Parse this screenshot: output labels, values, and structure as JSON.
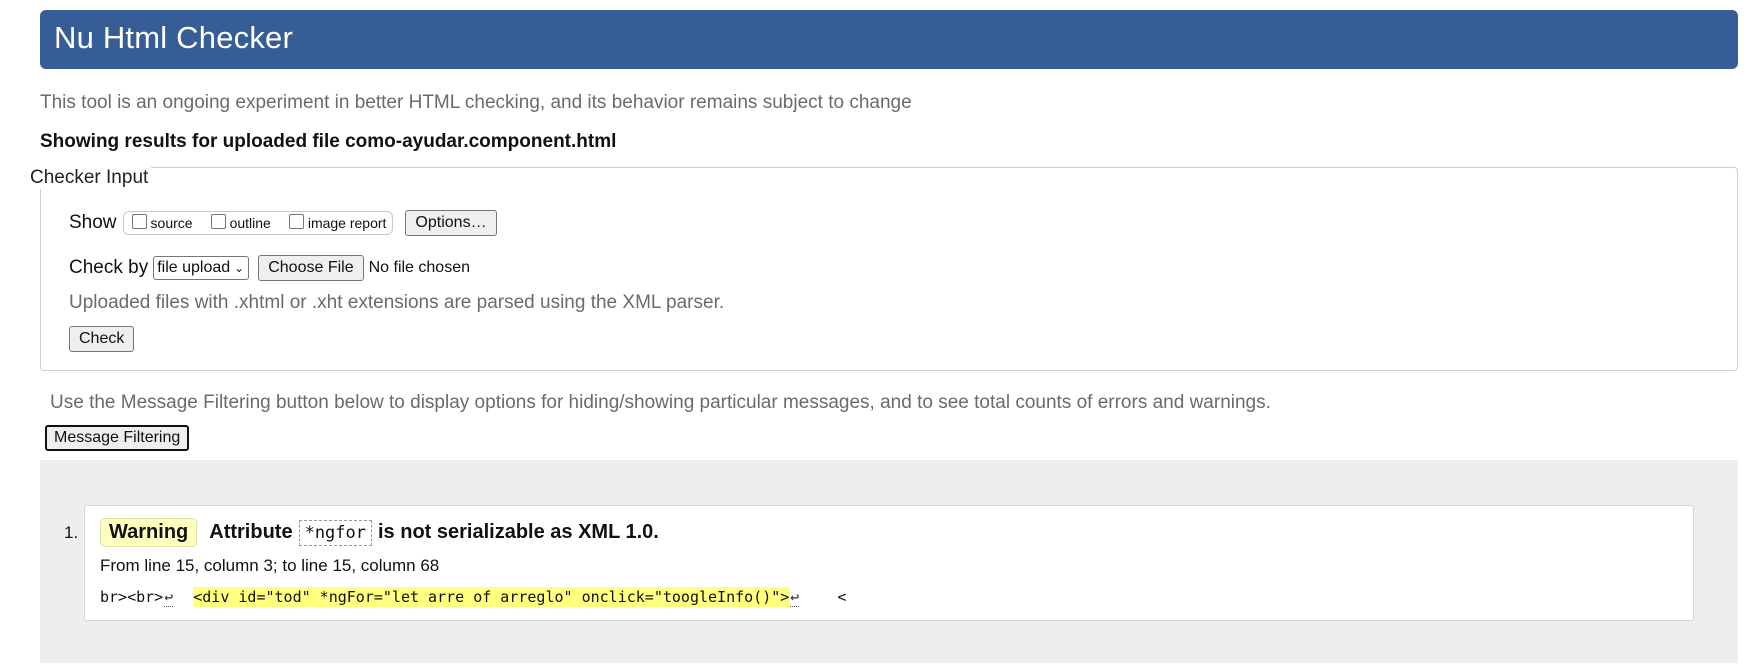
{
  "header": {
    "title": "Nu Html Checker"
  },
  "tagline": "This tool is an ongoing experiment in better HTML checking, and its behavior remains subject to change",
  "results_for": "Showing results for uploaded file como-ayudar.component.html",
  "checker_input": {
    "legend": "Checker Input",
    "show_label": "Show",
    "show_options": [
      "source",
      "outline",
      "image report"
    ],
    "options_button": "Options…",
    "check_by_label": "Check by",
    "check_by_selected": "file upload",
    "choose_file_button": "Choose File",
    "file_status": "No file chosen",
    "parser_note": "Uploaded files with .xhtml or .xht extensions are parsed using the XML parser.",
    "check_button": "Check"
  },
  "filtering": {
    "text": "Use the Message Filtering button below to display options for hiding/showing particular messages, and to see total counts of errors and warnings.",
    "button": "Message Filtering"
  },
  "messages": [
    {
      "number": "1.",
      "type": "Warning",
      "text_before": "Attribute",
      "code": "*ngfor",
      "text_after": "is not serializable as XML 1.0.",
      "location": "From line 15, column 3; to line 15, column 68",
      "extract_before": "br><br>",
      "extract_return": "↩",
      "extract_highlight": "<div id=\"tod\" *ngFor=\"let arre of arreglo\" onclick=\"toogleInfo()\">",
      "extract_return_after": "↩",
      "extract_tail": "<"
    }
  ]
}
